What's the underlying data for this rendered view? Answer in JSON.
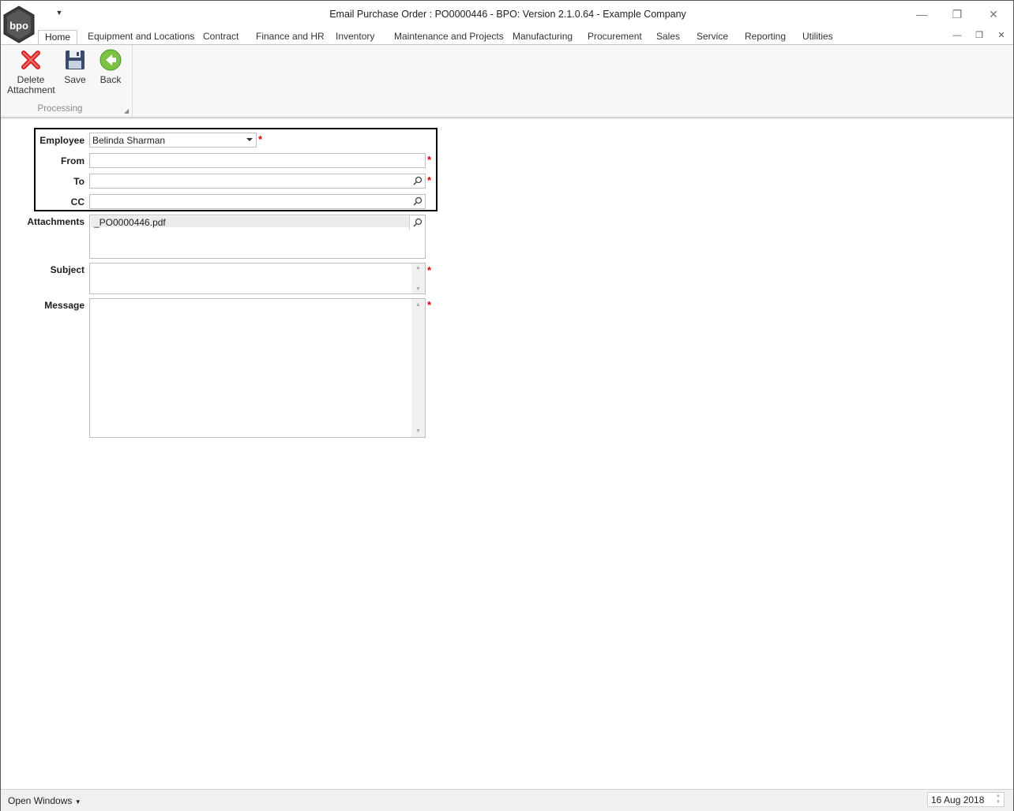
{
  "window": {
    "title": "Email Purchase Order : PO0000446 - BPO: Version 2.1.0.64 - Example Company",
    "logo_text": "bpo"
  },
  "menu": {
    "tabs": [
      {
        "label": "Home"
      },
      {
        "label": "Equipment and Locations"
      },
      {
        "label": "Contract"
      },
      {
        "label": "Finance and HR"
      },
      {
        "label": "Inventory"
      },
      {
        "label": "Maintenance and Projects"
      },
      {
        "label": "Manufacturing"
      },
      {
        "label": "Procurement"
      },
      {
        "label": "Sales"
      },
      {
        "label": "Service"
      },
      {
        "label": "Reporting"
      },
      {
        "label": "Utilities"
      }
    ]
  },
  "ribbon": {
    "group_label": "Processing",
    "buttons": {
      "delete_line1": "Delete",
      "delete_line2": "Attachment",
      "save": "Save",
      "back": "Back"
    }
  },
  "form": {
    "employee_label": "Employee",
    "employee_value": "Belinda Sharman",
    "from_label": "From",
    "from_value": "",
    "to_label": "To",
    "to_value": "",
    "cc_label": "CC",
    "cc_value": "",
    "attachments_label": "Attachments",
    "attachment_item": "_PO0000446.pdf",
    "subject_label": "Subject",
    "message_label": "Message",
    "required_marker": "*"
  },
  "status": {
    "open_windows": "Open Windows",
    "date": "16 Aug 2018"
  },
  "colors": {
    "required": "#e00000",
    "delete_icon": "#d32222",
    "back_icon": "#7bc144",
    "save_icon": "#3a4a6a"
  }
}
